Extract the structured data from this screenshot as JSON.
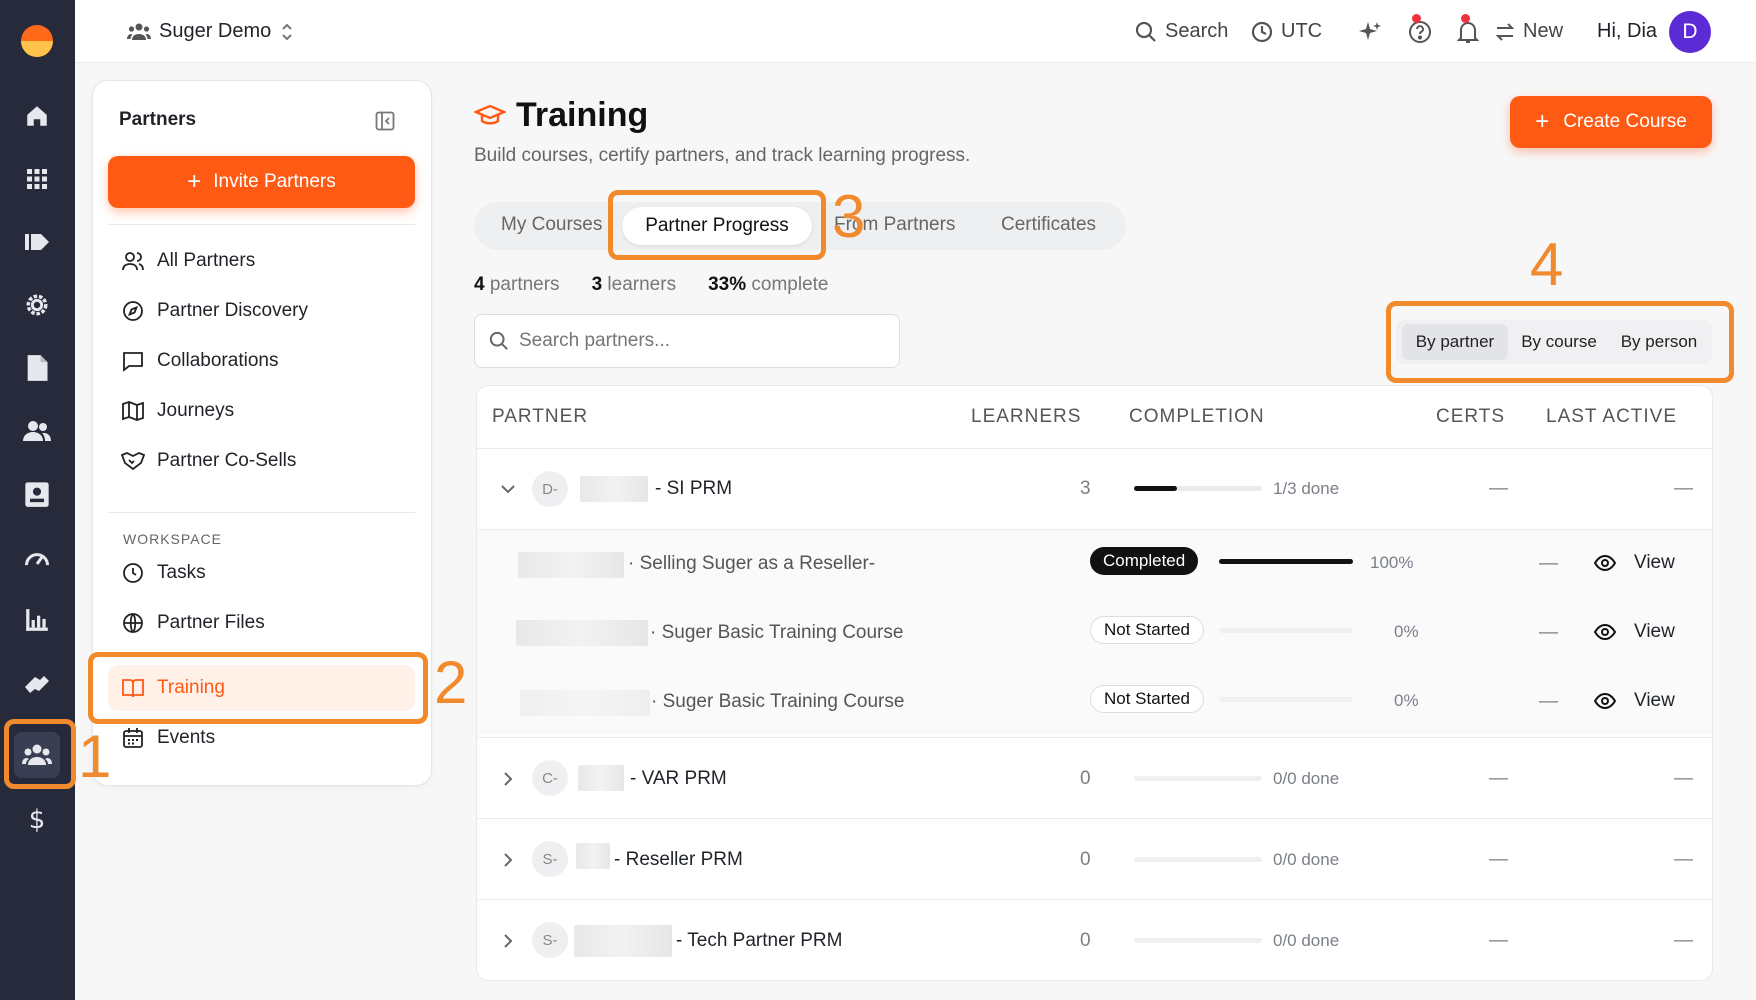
{
  "workspace": {
    "name": "Suger Demo"
  },
  "topbar": {
    "search": "Search",
    "timezone": "UTC",
    "new": "New",
    "greeting": "Hi, Dia",
    "avatar_initial": "D"
  },
  "sidebar": {
    "title": "Partners",
    "invite_button": "Invite Partners",
    "items": [
      {
        "label": "All Partners",
        "icon": "users-icon"
      },
      {
        "label": "Partner Discovery",
        "icon": "compass-icon"
      },
      {
        "label": "Collaborations",
        "icon": "chat-icon"
      },
      {
        "label": "Journeys",
        "icon": "map-icon"
      },
      {
        "label": "Partner Co-Sells",
        "icon": "handshake-icon"
      }
    ],
    "workspace_heading": "WORKSPACE",
    "workspace_items": [
      {
        "label": "Tasks",
        "icon": "clock-icon"
      },
      {
        "label": "Partner Files",
        "icon": "globe-icon"
      },
      {
        "label": "Training",
        "icon": "book-icon",
        "active": true
      },
      {
        "label": "Events",
        "icon": "calendar-icon"
      }
    ]
  },
  "page": {
    "title": "Training",
    "subtitle": "Build courses, certify partners, and track learning progress.",
    "create_button": "Create Course"
  },
  "tabs": [
    {
      "label": "My Courses"
    },
    {
      "label": "Partner Progress",
      "active": true
    },
    {
      "label": "From Partners"
    },
    {
      "label": "Certificates"
    }
  ],
  "stats": {
    "partners_count": "4",
    "partners_label": "partners",
    "learners_count": "3",
    "learners_label": "learners",
    "complete_pct": "33%",
    "complete_label": "complete"
  },
  "search_placeholder": "Search partners...",
  "view_toggle": [
    {
      "label": "By partner",
      "active": true
    },
    {
      "label": "By course"
    },
    {
      "label": "By person"
    }
  ],
  "table": {
    "columns": [
      "PARTNER",
      "LEARNERS",
      "COMPLETION",
      "CERTS",
      "LAST ACTIVE"
    ],
    "partners": [
      {
        "avatar": "D-",
        "name": "- SI PRM",
        "learners": "3",
        "progress": 0.333,
        "done": "1/3 done",
        "certs": "—",
        "last_active": "—",
        "expanded": true,
        "courses": [
          {
            "name": "· Selling Suger as a Reseller-",
            "status": "Completed",
            "progress": 1.0,
            "pct": "100%",
            "certs": "—",
            "action": "View"
          },
          {
            "name": "· Suger Basic Training Course",
            "status": "Not Started",
            "progress": 0,
            "pct": "0%",
            "certs": "—",
            "action": "View"
          },
          {
            "name": "· Suger Basic Training Course",
            "status": "Not Started",
            "progress": 0,
            "pct": "0%",
            "certs": "—",
            "action": "View"
          }
        ]
      },
      {
        "avatar": "C-",
        "name": "- VAR PRM",
        "learners": "0",
        "progress": 0,
        "done": "0/0 done",
        "certs": "—",
        "last_active": "—"
      },
      {
        "avatar": "S-",
        "name": "- Reseller PRM",
        "learners": "0",
        "progress": 0,
        "done": "0/0 done",
        "certs": "—",
        "last_active": "—"
      },
      {
        "avatar": "S-",
        "name": "- Tech Partner PRM",
        "learners": "0",
        "progress": 0,
        "done": "0/0 done",
        "certs": "—",
        "last_active": "—"
      }
    ]
  },
  "annotations": [
    "1",
    "2",
    "3",
    "4"
  ],
  "colors": {
    "accent": "#ff5a14",
    "highlight": "#f08a2c",
    "rail": "#272a3a"
  }
}
